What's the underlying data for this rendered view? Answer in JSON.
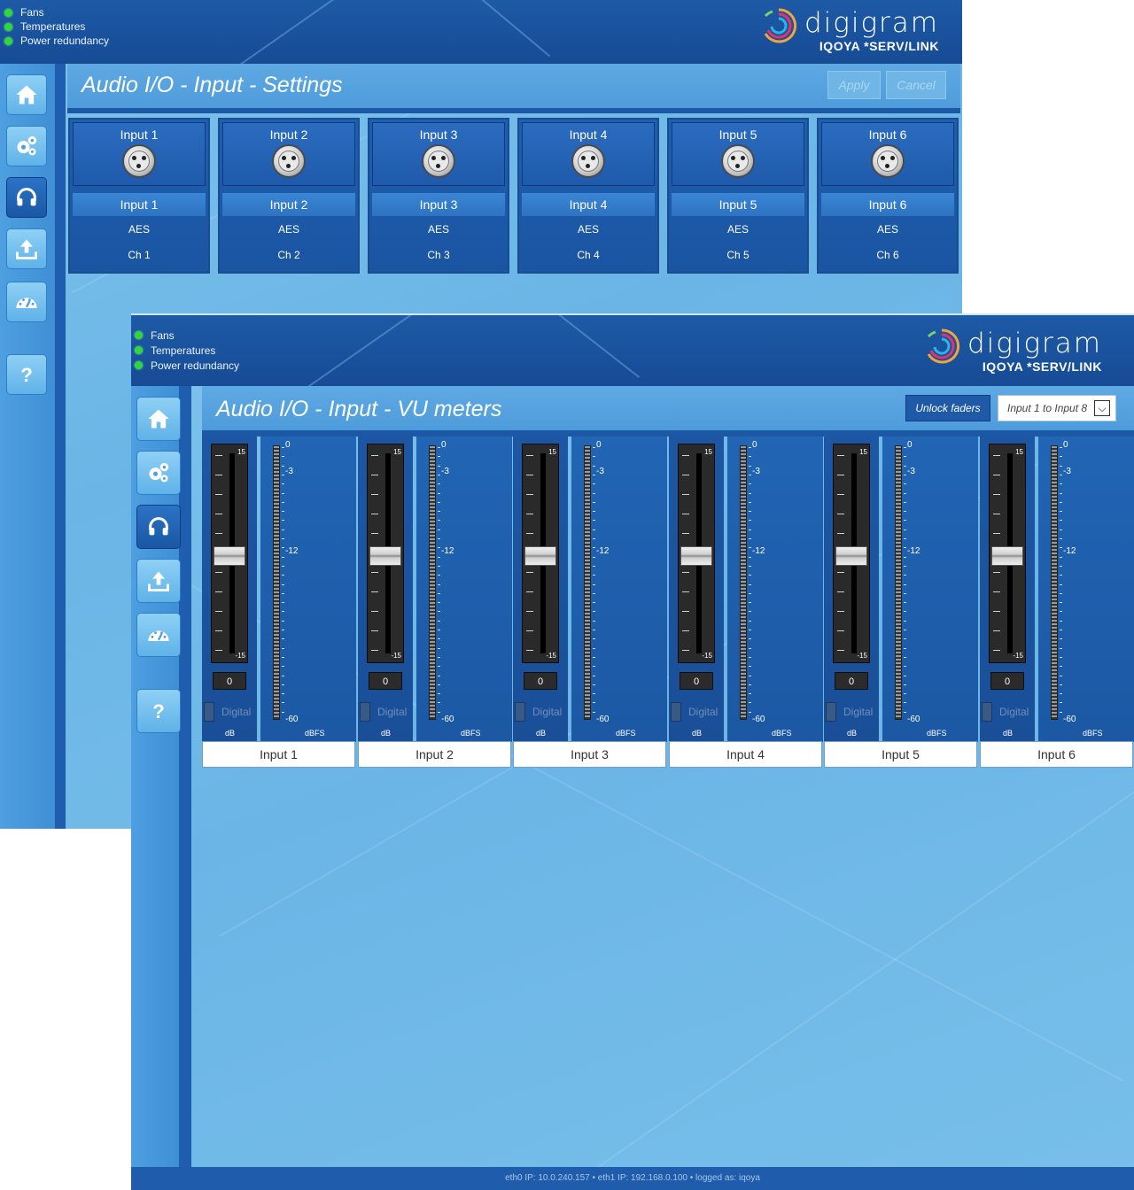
{
  "status": {
    "items": [
      "Fans",
      "Temperatures",
      "Power redundancy"
    ],
    "indicator_color": "#2fd83a"
  },
  "brand": {
    "name": "digigram",
    "product": "IQOYA *SERV/LINK"
  },
  "sidebar": {
    "items": [
      {
        "icon": "home-icon",
        "label": "Home"
      },
      {
        "icon": "gears-icon",
        "label": "Settings"
      },
      {
        "icon": "headphones-icon",
        "label": "Audio I/O",
        "active": true
      },
      {
        "icon": "upload-icon",
        "label": "Upload"
      },
      {
        "icon": "gauge-icon",
        "label": "Monitoring"
      },
      {
        "icon": "help-icon",
        "label": "Help"
      }
    ]
  },
  "settings_window": {
    "title": "Audio I/O - Input - Settings",
    "apply_label": "Apply",
    "cancel_label": "Cancel",
    "inputs": [
      {
        "connector_label": "Input 1",
        "name": "Input 1",
        "type": "AES",
        "channel": "Ch 1"
      },
      {
        "connector_label": "Input 2",
        "name": "Input 2",
        "type": "AES",
        "channel": "Ch 2"
      },
      {
        "connector_label": "Input 3",
        "name": "Input 3",
        "type": "AES",
        "channel": "Ch 3"
      },
      {
        "connector_label": "Input 4",
        "name": "Input 4",
        "type": "AES",
        "channel": "Ch 4"
      },
      {
        "connector_label": "Input 5",
        "name": "Input 5",
        "type": "AES",
        "channel": "Ch 5"
      },
      {
        "connector_label": "Input 6",
        "name": "Input 6",
        "type": "AES",
        "channel": "Ch 6"
      }
    ]
  },
  "vu_window": {
    "title": "Audio I/O - Input - VU meters",
    "unlock_label": "Unlock faders",
    "range_select_value": "Input 1 to Input 8",
    "fader_scale_top": "15",
    "fader_scale_bottom": "-15",
    "meter_scale": [
      "0",
      "-3",
      "-12",
      "-60"
    ],
    "fader_unit": "dB",
    "meter_unit": "dBFS",
    "digital_label": "Digital",
    "strips": [
      {
        "name": "Input 1",
        "gain": "0"
      },
      {
        "name": "Input 2",
        "gain": "0"
      },
      {
        "name": "Input 3",
        "gain": "0"
      },
      {
        "name": "Input 4",
        "gain": "0"
      },
      {
        "name": "Input 5",
        "gain": "0"
      },
      {
        "name": "Input 6",
        "gain": "0"
      }
    ],
    "footer_text": "eth0 IP: 10.0.240.157  •  eth1 IP: 192.168.0.100  •  logged as: iqoya"
  }
}
